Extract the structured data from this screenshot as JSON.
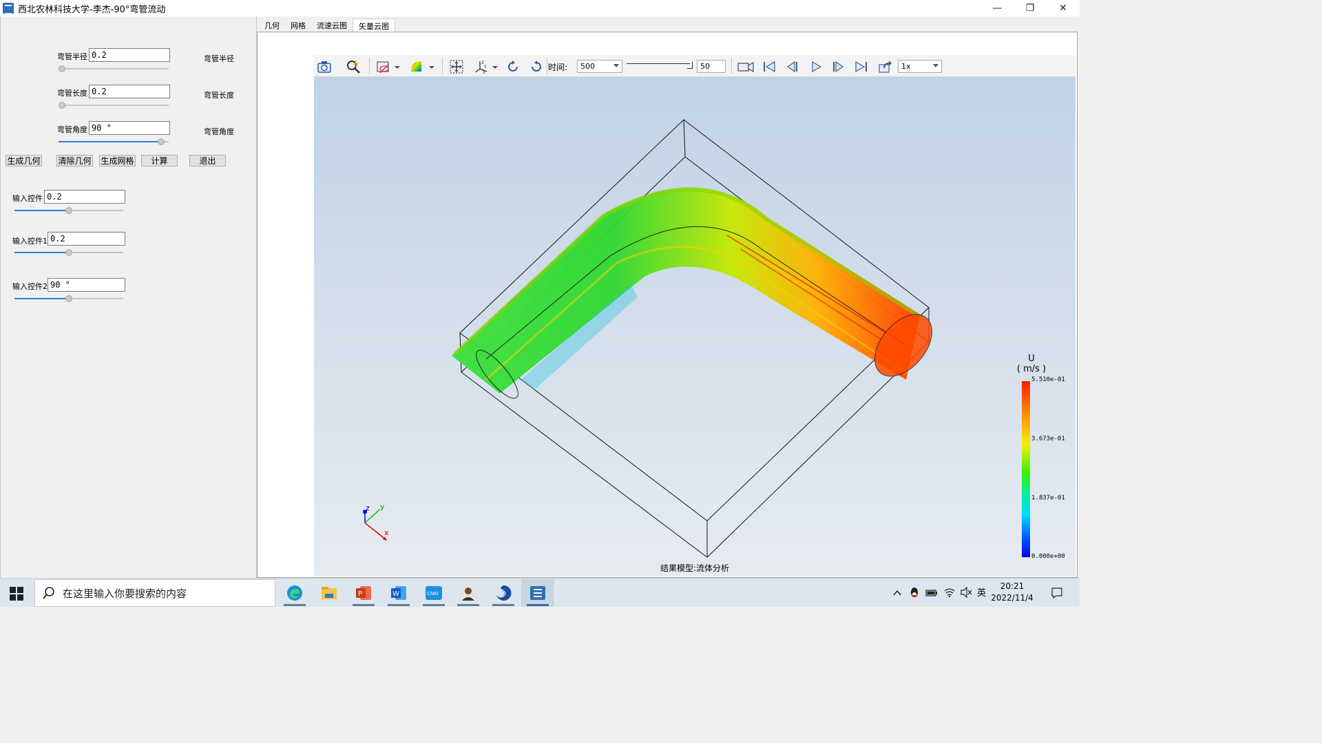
{
  "window": {
    "title": "西北农林科技大学-李杰-90°弯管流动",
    "minimize": "—",
    "maximize": "❐",
    "close": "✕"
  },
  "left_panel": {
    "params": [
      {
        "label": "弯管半径",
        "value": "0.2",
        "right_label": "弯管半径",
        "slider_value": 0.0
      },
      {
        "label": "弯管长度",
        "value": "0.2",
        "right_label": "弯管长度",
        "slider_value": 0.0
      },
      {
        "label": "弯管角度",
        "value": "90 °",
        "right_label": "弯管角度",
        "slider_value": 1.0
      }
    ],
    "buttons": {
      "generate_geometry": "生成几何",
      "clear_geometry": "清除几何",
      "generate_mesh": "生成网格",
      "compute": "计算",
      "exit": "退出"
    },
    "inputs": [
      {
        "label": "输入控件",
        "value": "0.2",
        "slider_value": 0.5
      },
      {
        "label": "输入控件1",
        "value": "0.2",
        "slider_value": 0.5
      },
      {
        "label": "输入控件2",
        "value": "90 °",
        "slider_value": 0.5
      }
    ]
  },
  "tabs": [
    "几何",
    "网格",
    "流速云图",
    "矢量云图"
  ],
  "active_tab": 3,
  "toolbar": {
    "time_label": "时间:",
    "time_value": "500",
    "frame_value": "50",
    "speed_value": "1x"
  },
  "viewport": {
    "caption": "结果模型:流体分析",
    "axes": {
      "x": "x",
      "y": "y",
      "z": "z"
    },
    "legend": {
      "title_line1": "U",
      "title_line2": "( m/s )",
      "ticks": [
        "5.510e-01",
        "3.673e-01",
        "1.837e-01",
        "0.000e+00"
      ]
    }
  },
  "taskbar": {
    "search_placeholder": "在这里输入你要搜索的内容",
    "apps": [
      "edge-icon",
      "file-explorer-icon",
      "powerpoint-icon",
      "word-icon",
      "cnki-icon",
      "avatar-app-icon",
      "swirl-app-icon",
      "app-window-icon"
    ],
    "ime": "英",
    "time": "20:21",
    "date": "2022/11/4"
  },
  "colors": {
    "accent": "#2a7ad5",
    "legend_max": "#ff1d00",
    "legend_min": "#0000e0"
  }
}
